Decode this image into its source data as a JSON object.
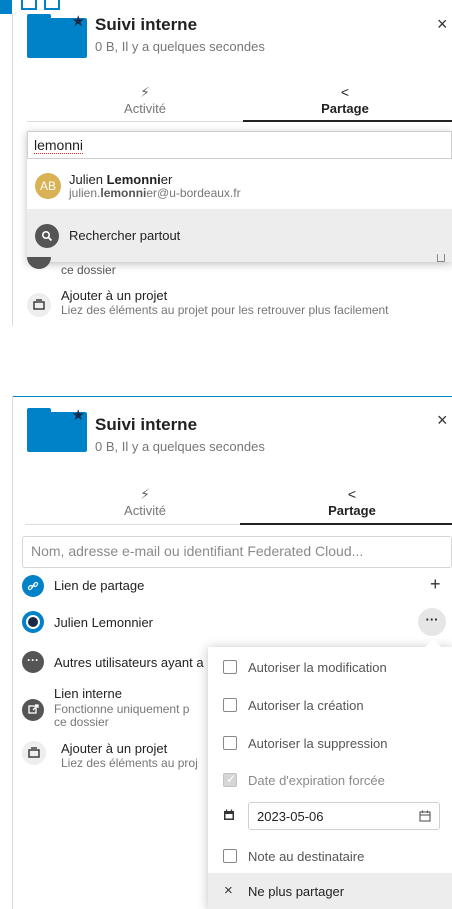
{
  "top_panel": {
    "title": "Suivi interne",
    "subtitle": "0 B, Il y a quelques secondes",
    "close_symbol": "×",
    "tabs": [
      {
        "icon": "⚡",
        "label": "Activité"
      },
      {
        "icon": "<",
        "label": "Partage"
      }
    ],
    "search_value": "lemonni",
    "suggestion": {
      "avatar": "AB",
      "name_prefix": "Julien ",
      "name_bold": "Lemonni",
      "name_suffix": "er",
      "email_prefix": "julien.",
      "email_bold": "lemonni",
      "email_suffix": "er@u-bordeaux.fr"
    },
    "search_everywhere": "Rechercher partout",
    "obscured_text": "ce dossier",
    "project_title": "Ajouter à un projet",
    "project_subtitle": "Liez des éléments au projet pour les retrouver plus facilement"
  },
  "bottom_panel": {
    "title": "Suivi interne",
    "subtitle": "0 B, Il y a quelques secondes",
    "close_symbol": "×",
    "tabs": [
      {
        "icon": "⚡",
        "label": "Activité"
      },
      {
        "icon": "<",
        "label": "Partage"
      }
    ],
    "share_placeholder": "Nom, adresse e-mail ou identifiant Federated Cloud...",
    "share_link_label": "Lien de partage",
    "add_symbol": "+",
    "shared_user": "Julien Lemonnier",
    "more_symbol": "···",
    "other_users": "Autres utilisateurs ayant a",
    "internal_link_title": "Lien interne",
    "internal_link_sub1": "Fonctionne uniquement p",
    "internal_link_sub2": "ce dossier",
    "project_title": "Ajouter à un projet",
    "project_subtitle": "Liez des éléments au proj"
  },
  "menu": {
    "items": [
      {
        "label": "Autoriser la modification",
        "checked": false,
        "disabled": false
      },
      {
        "label": "Autoriser la création",
        "checked": false,
        "disabled": false
      },
      {
        "label": "Autoriser la suppression",
        "checked": false,
        "disabled": false
      },
      {
        "label": "Date d'expiration forcée",
        "checked": true,
        "disabled": true
      }
    ],
    "expiration_date": "2023-05-06",
    "note_label": "Note au destinataire",
    "unshare_label": "Ne plus partager",
    "unshare_symbol": "×"
  }
}
